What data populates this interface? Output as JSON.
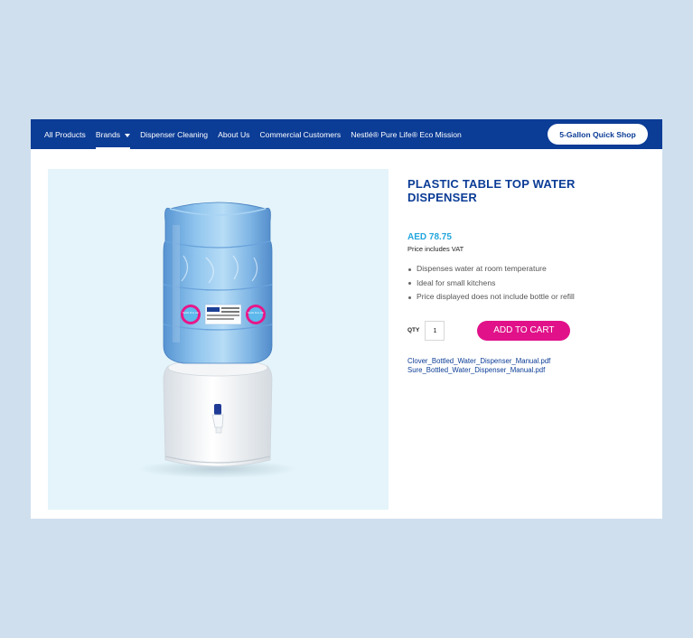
{
  "nav": {
    "items": [
      {
        "label": "All Products"
      },
      {
        "label": "Brands"
      },
      {
        "label": "Dispenser Cleaning"
      },
      {
        "label": "About Us"
      },
      {
        "label": "Commercial Customers"
      },
      {
        "label": "Nestlé® Pure Life® Eco Mission"
      }
    ],
    "active_item": "Brands",
    "quick_shop_label": "5-Gallon Quick Shop"
  },
  "product": {
    "title": "PLASTIC TABLE TOP WATER DISPENSER",
    "price": "AED 78.75",
    "vat_note": "Price includes VAT",
    "features": [
      "Dispenses water at room temperature",
      "Ideal for small kitchens",
      "Price displayed does not include bottle or refill"
    ],
    "qty_label": "QTY",
    "qty_value": "1",
    "add_to_cart_label": "ADD TO CART",
    "files": [
      "Clover_Bottled_Water_Dispenser_Manual.pdf",
      "Sure_Bottled_Water_Dispenser_Manual.pdf"
    ]
  },
  "image": {
    "bottle_label_brand": "Nestlé Pure Life",
    "bottle_label_sub": "Nestlé Pure Life"
  },
  "colors": {
    "nav_bg": "#0b3c96",
    "accent_pink": "#e1118a",
    "price_blue": "#22a6dd",
    "page_bg": "#cfdfee",
    "image_bg": "#e4f4fa"
  }
}
